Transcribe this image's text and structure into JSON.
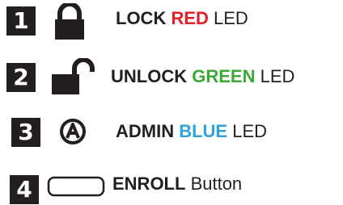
{
  "rows": [
    {
      "number": "1",
      "icon": "locked-padlock-icon",
      "label_pre": "LOCK ",
      "label_color_word": "RED",
      "label_post": " LED",
      "color": "#e31e25"
    },
    {
      "number": "2",
      "icon": "unlocked-padlock-icon",
      "label_pre": "UNLOCK ",
      "label_color_word": "GREEN",
      "label_post": " LED",
      "color": "#3aaa35"
    },
    {
      "number": "3",
      "icon": "admin-a-circle-icon",
      "label_pre": "ADMIN ",
      "label_color_word": "BLUE",
      "label_post": " LED",
      "color": "#2ea3dc"
    },
    {
      "number": "4",
      "icon": "enroll-button-icon",
      "label_bold": "ENROLL",
      "label_post": " Button"
    }
  ]
}
